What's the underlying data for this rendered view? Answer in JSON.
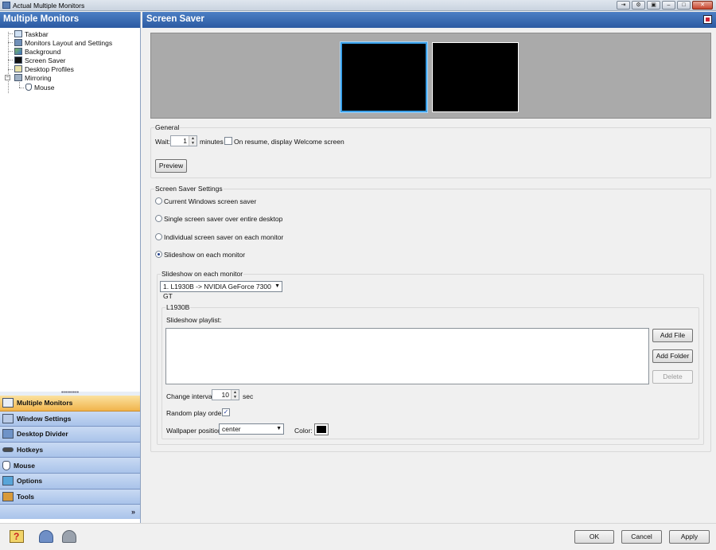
{
  "window": {
    "title": "Actual Multiple Monitors",
    "controls": [
      "⇥",
      "⚙",
      "▣",
      "–",
      "□",
      "✕"
    ]
  },
  "left_panel": {
    "header": "Multiple Monitors",
    "tree": [
      {
        "label": "Taskbar",
        "icon": "taskbar-icon"
      },
      {
        "label": "Monitors Layout and Settings",
        "icon": "monitor-icon"
      },
      {
        "label": "Background",
        "icon": "background-icon"
      },
      {
        "label": "Screen Saver",
        "icon": "screen-saver-icon"
      },
      {
        "label": "Desktop Profiles",
        "icon": "desktop-profiles-icon"
      },
      {
        "label": "Mirroring",
        "icon": "mirroring-icon"
      },
      {
        "label": "Mouse",
        "icon": "mouse-icon"
      }
    ],
    "splitter_grip": "•••••••••",
    "nav": [
      {
        "label": "Multiple Monitors",
        "active": true
      },
      {
        "label": "Window Settings"
      },
      {
        "label": "Desktop Divider"
      },
      {
        "label": "Hotkeys"
      },
      {
        "label": "Mouse"
      },
      {
        "label": "Options"
      },
      {
        "label": "Tools"
      }
    ],
    "nav_more": "»"
  },
  "right_panel": {
    "header": "Screen Saver",
    "general": {
      "title": "General",
      "wait_label": "Wait:",
      "wait_value": "1",
      "minutes_label": "minutes",
      "resume_label": "On resume, display Welcome screen",
      "resume_checked": false,
      "preview_button": "Preview"
    },
    "settings": {
      "title": "Screen Saver Settings",
      "options": [
        {
          "label": "Current Windows screen saver",
          "selected": false
        },
        {
          "label": "Single screen saver over entire desktop",
          "selected": false
        },
        {
          "label": "Individual screen saver on each monitor",
          "selected": false
        },
        {
          "label": "Slideshow on each monitor",
          "selected": true
        }
      ]
    },
    "slideshow": {
      "title": "Slideshow on each monitor",
      "monitor_select": "1. L1930B -> NVIDIA GeForce 7300 GT",
      "monitor_group_title": "L1930B",
      "playlist_label": "Slideshow playlist:",
      "add_file": "Add File",
      "add_folder": "Add Folder",
      "delete": "Delete",
      "interval_label": "Change interval:",
      "interval_value": "10",
      "interval_unit": "sec",
      "random_label": "Random play order",
      "random_checked": true,
      "wallpaper_label": "Wallpaper position:",
      "wallpaper_value": "center",
      "color_label": "Color:",
      "color_value": "#000000"
    }
  },
  "footer": {
    "ok": "OK",
    "cancel": "Cancel",
    "apply": "Apply"
  },
  "glyphs": {
    "dropdown": "▼",
    "spin_up": "▲",
    "spin_down": "▼",
    "check": "✓",
    "expander_minus": "−"
  }
}
